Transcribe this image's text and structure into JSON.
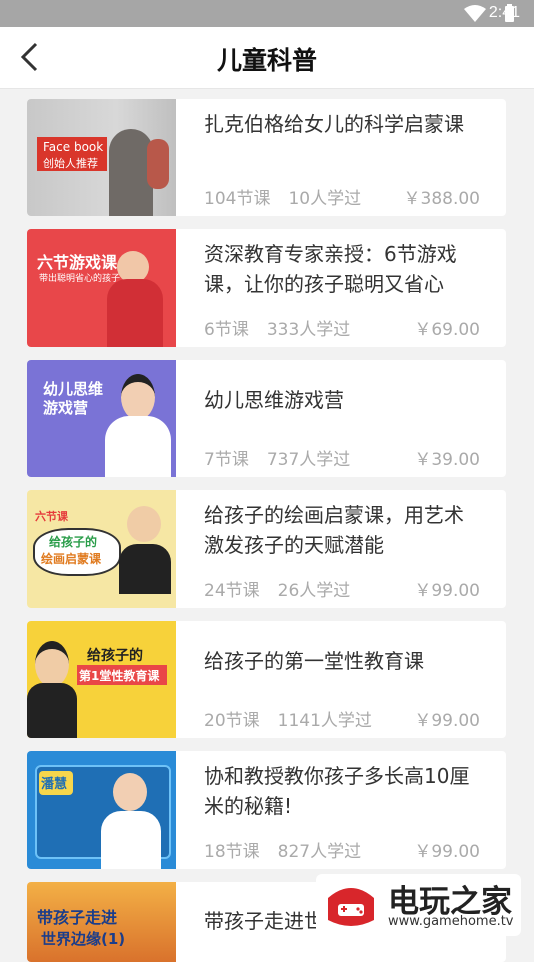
{
  "status": {
    "time": "2:41"
  },
  "header": {
    "title": "儿童科普"
  },
  "courses": [
    {
      "title": "扎克伯格给女儿的科学启蒙课",
      "lessons": "104节课",
      "learners": "10人学过",
      "price": "￥388.00",
      "thumb_text": [
        "Face book",
        "创始人推荐"
      ]
    },
    {
      "title": "资深教育专家亲授：6节游戏课，让你的孩子聪明又省心",
      "lessons": "6节课",
      "learners": "333人学过",
      "price": "￥69.00",
      "thumb_text": [
        "六节游戏课",
        "带出聪明省心的孩子"
      ]
    },
    {
      "title": "幼儿思维游戏营",
      "lessons": "7节课",
      "learners": "737人学过",
      "price": "￥39.00",
      "thumb_text": [
        "幼儿思维",
        "游戏营"
      ]
    },
    {
      "title": "给孩子的绘画启蒙课，用艺术激发孩子的天赋潜能",
      "lessons": "24节课",
      "learners": "26人学过",
      "price": "￥99.00",
      "thumb_text": [
        "六节课",
        "给孩子的",
        "绘画启蒙课"
      ]
    },
    {
      "title": "给孩子的第一堂性教育课",
      "lessons": "20节课",
      "learners": "1141人学过",
      "price": "￥99.00",
      "thumb_text": [
        "给孩子的",
        "第1堂性教育课"
      ]
    },
    {
      "title": "协和教授教你孩子多长高10厘米的秘籍!",
      "lessons": "18节课",
      "learners": "827人学过",
      "price": "￥99.00",
      "thumb_text": [
        "潘慧"
      ]
    },
    {
      "title": "带孩子走进世界边缘",
      "lessons": "",
      "learners": "",
      "price": "",
      "thumb_text": [
        "带孩子走进",
        "世界边缘(1)"
      ]
    }
  ],
  "watermark": {
    "name": "电玩之家",
    "url": "www.gamehome.tv"
  }
}
